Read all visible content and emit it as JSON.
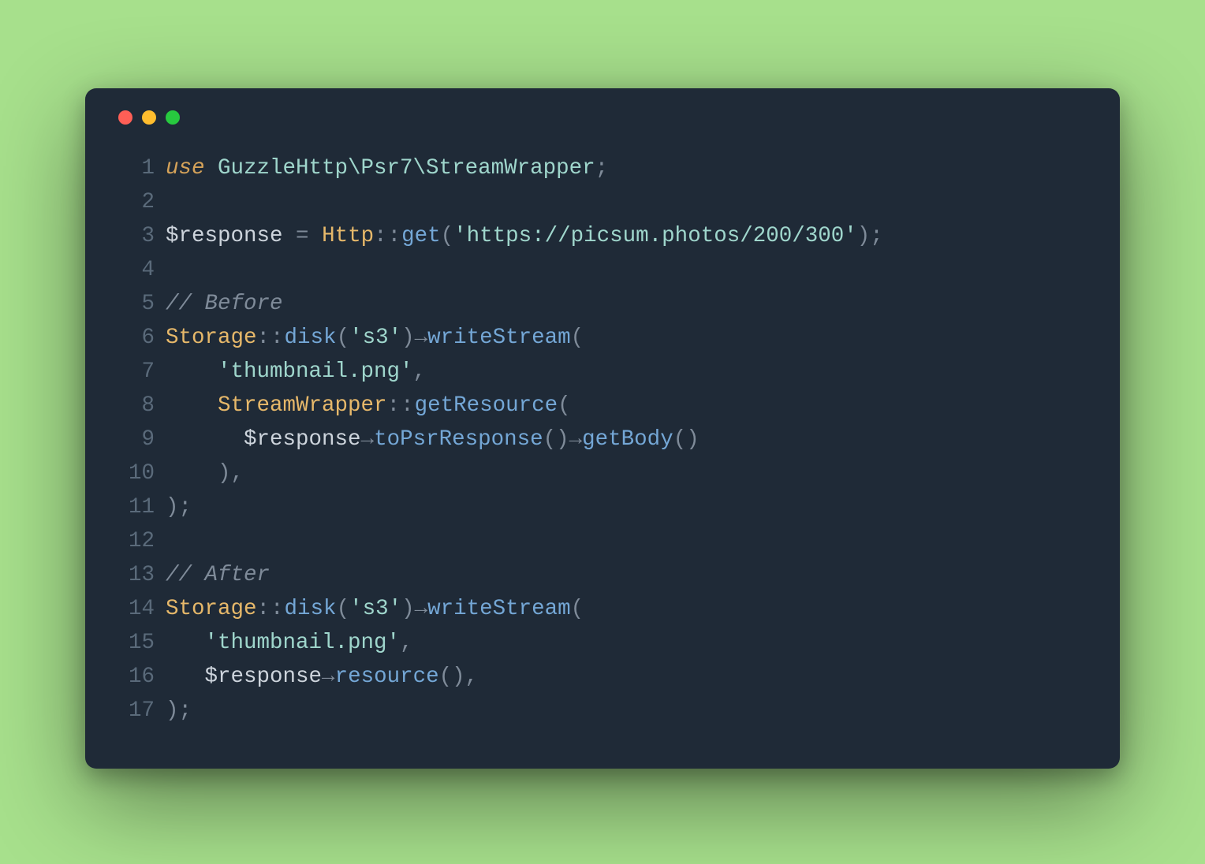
{
  "window": {
    "traffic_lights": [
      "red",
      "yellow",
      "green"
    ]
  },
  "code": {
    "language": "php",
    "lines": [
      {
        "n": 1,
        "tokens": [
          {
            "t": "use ",
            "c": "keyword"
          },
          {
            "t": "GuzzleHttp\\Psr7\\StreamWrapper",
            "c": "namespace"
          },
          {
            "t": ";",
            "c": "punct"
          }
        ]
      },
      {
        "n": 2,
        "tokens": []
      },
      {
        "n": 3,
        "tokens": [
          {
            "t": "$response",
            "c": "variable"
          },
          {
            "t": " ",
            "c": "punct"
          },
          {
            "t": "=",
            "c": "punct"
          },
          {
            "t": " ",
            "c": "punct"
          },
          {
            "t": "Http",
            "c": "class"
          },
          {
            "t": "::",
            "c": "dbl-colon"
          },
          {
            "t": "get",
            "c": "method"
          },
          {
            "t": "(",
            "c": "punct"
          },
          {
            "t": "'https://picsum.photos/200/300'",
            "c": "string"
          },
          {
            "t": ")",
            "c": "punct"
          },
          {
            "t": ";",
            "c": "punct"
          }
        ]
      },
      {
        "n": 4,
        "tokens": []
      },
      {
        "n": 5,
        "tokens": [
          {
            "t": "// Before",
            "c": "comment"
          }
        ]
      },
      {
        "n": 6,
        "tokens": [
          {
            "t": "Storage",
            "c": "class"
          },
          {
            "t": "::",
            "c": "dbl-colon"
          },
          {
            "t": "disk",
            "c": "method"
          },
          {
            "t": "(",
            "c": "punct"
          },
          {
            "t": "'s3'",
            "c": "string"
          },
          {
            "t": ")",
            "c": "punct"
          },
          {
            "t": "→",
            "c": "arrow"
          },
          {
            "t": "writeStream",
            "c": "method"
          },
          {
            "t": "(",
            "c": "punct"
          }
        ]
      },
      {
        "n": 7,
        "tokens": [
          {
            "t": "    ",
            "c": "punct"
          },
          {
            "t": "'thumbnail.png'",
            "c": "string"
          },
          {
            "t": ",",
            "c": "punct"
          }
        ]
      },
      {
        "n": 8,
        "tokens": [
          {
            "t": "    ",
            "c": "punct"
          },
          {
            "t": "StreamWrapper",
            "c": "class"
          },
          {
            "t": "::",
            "c": "dbl-colon"
          },
          {
            "t": "getResource",
            "c": "method"
          },
          {
            "t": "(",
            "c": "punct"
          }
        ]
      },
      {
        "n": 9,
        "tokens": [
          {
            "t": "      ",
            "c": "punct"
          },
          {
            "t": "$response",
            "c": "variable"
          },
          {
            "t": "→",
            "c": "arrow"
          },
          {
            "t": "toPsrResponse",
            "c": "method"
          },
          {
            "t": "(",
            "c": "punct"
          },
          {
            "t": ")",
            "c": "punct"
          },
          {
            "t": "→",
            "c": "arrow"
          },
          {
            "t": "getBody",
            "c": "method"
          },
          {
            "t": "(",
            "c": "punct"
          },
          {
            "t": ")",
            "c": "punct"
          }
        ]
      },
      {
        "n": 10,
        "tokens": [
          {
            "t": "    ",
            "c": "punct"
          },
          {
            "t": ")",
            "c": "punct"
          },
          {
            "t": ",",
            "c": "punct"
          }
        ]
      },
      {
        "n": 11,
        "tokens": [
          {
            "t": ")",
            "c": "punct"
          },
          {
            "t": ";",
            "c": "punct"
          }
        ]
      },
      {
        "n": 12,
        "tokens": []
      },
      {
        "n": 13,
        "tokens": [
          {
            "t": "// After",
            "c": "comment"
          }
        ]
      },
      {
        "n": 14,
        "tokens": [
          {
            "t": "Storage",
            "c": "class"
          },
          {
            "t": "::",
            "c": "dbl-colon"
          },
          {
            "t": "disk",
            "c": "method"
          },
          {
            "t": "(",
            "c": "punct"
          },
          {
            "t": "'s3'",
            "c": "string"
          },
          {
            "t": ")",
            "c": "punct"
          },
          {
            "t": "→",
            "c": "arrow"
          },
          {
            "t": "writeStream",
            "c": "method"
          },
          {
            "t": "(",
            "c": "punct"
          }
        ]
      },
      {
        "n": 15,
        "tokens": [
          {
            "t": "   ",
            "c": "punct"
          },
          {
            "t": "'thumbnail.png'",
            "c": "string"
          },
          {
            "t": ",",
            "c": "punct"
          }
        ]
      },
      {
        "n": 16,
        "tokens": [
          {
            "t": "   ",
            "c": "punct"
          },
          {
            "t": "$response",
            "c": "variable"
          },
          {
            "t": "→",
            "c": "arrow"
          },
          {
            "t": "resource",
            "c": "method"
          },
          {
            "t": "(",
            "c": "punct"
          },
          {
            "t": ")",
            "c": "punct"
          },
          {
            "t": ",",
            "c": "punct"
          }
        ]
      },
      {
        "n": 17,
        "tokens": [
          {
            "t": ")",
            "c": "punct"
          },
          {
            "t": ";",
            "c": "punct"
          }
        ]
      }
    ]
  }
}
